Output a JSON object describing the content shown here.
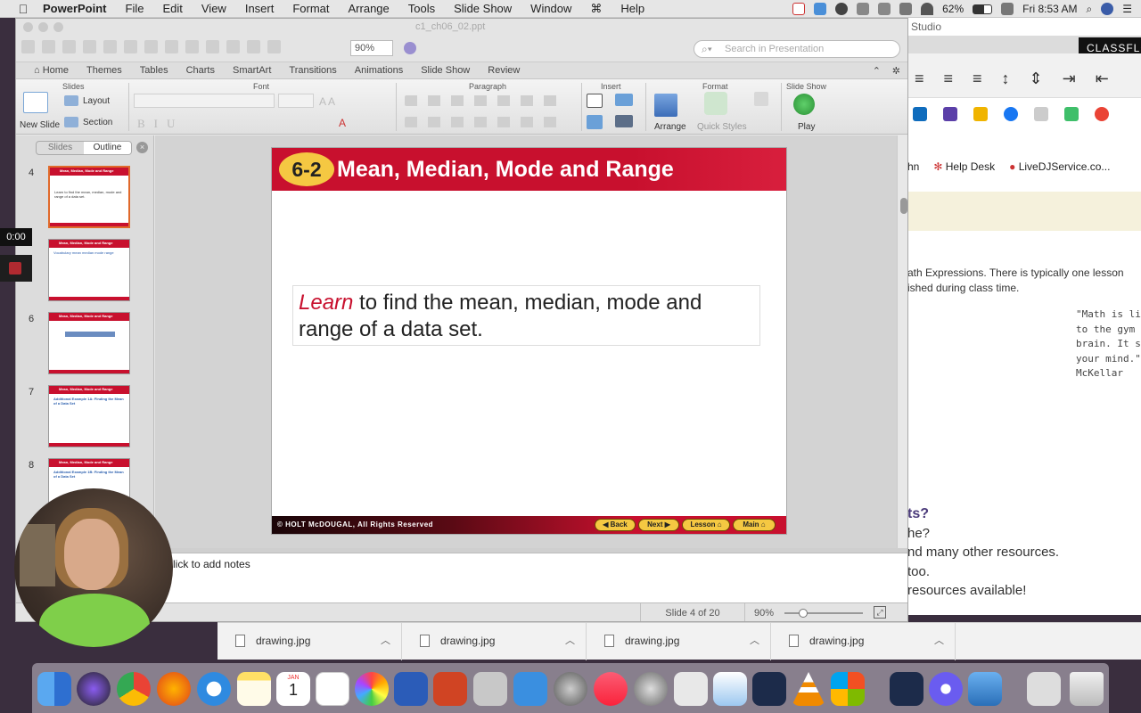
{
  "menubar": {
    "apple_glyph": "",
    "app_name": "PowerPoint",
    "items": [
      "File",
      "Edit",
      "View",
      "Insert",
      "Format",
      "Arrange",
      "Tools",
      "Slide Show",
      "Window",
      "Help"
    ],
    "battery": "62%",
    "clock": "Fri 8:53 AM"
  },
  "ppt": {
    "filename": "c1_ch06_02.ppt",
    "zoom_box": "90%",
    "search_placeholder": "Search in Presentation",
    "ribbon_tabs": [
      "Home",
      "Themes",
      "Tables",
      "Charts",
      "SmartArt",
      "Transitions",
      "Animations",
      "Slide Show",
      "Review"
    ],
    "groups": {
      "slides": "Slides",
      "font": "Font",
      "paragraph": "Paragraph",
      "insert": "Insert",
      "format": "Format",
      "slideshow": "Slide Show"
    },
    "buttons": {
      "new_slide": "New Slide",
      "layout": "Layout",
      "section": "Section",
      "arrange": "Arrange",
      "quick_styles": "Quick Styles",
      "play": "Play"
    },
    "pane_tabs": {
      "slides": "Slides",
      "outline": "Outline"
    },
    "thumbnails": [
      {
        "num": "4",
        "title": "Mean, Median, Mode and Range",
        "body": "Learn to find the mean, median, mode and range of a data set."
      },
      {
        "num": "",
        "title": "Mean, Median, Mode and Range",
        "body": "Vocabulary  mean  median  mode  range"
      },
      {
        "num": "6",
        "title": "Mean, Median, Mode and Range",
        "body": ""
      },
      {
        "num": "7",
        "title": "Mean, Median, Mode and Range",
        "body": "Additional Example 1A: Finding the Mean of a Data Set"
      },
      {
        "num": "8",
        "title": "Mean, Median, Mode and Range",
        "body": "Additional Example 1B: Finding the Mean of a Data Set"
      }
    ],
    "slide": {
      "lesson_number": "6-2",
      "title": "Mean, Median, Mode and Range",
      "learn_word": "Learn",
      "learn_rest": " to find the mean, median, mode and range of a data set.",
      "copyright": "© HOLT McDOUGAL, All Rights Reserved",
      "nav": [
        "Back",
        "Next",
        "Lesson",
        "Main"
      ]
    },
    "notes_placeholder": "lick to add notes",
    "status": {
      "slide_info": "Slide 4 of 20",
      "zoom": "90%"
    }
  },
  "recording": {
    "timer": "0:00"
  },
  "browser": {
    "studio": "Studio",
    "classflow": "CLASSFLO",
    "bookmarks": [
      "hn",
      "Help Desk",
      "LiveDJService.co..."
    ],
    "text_lines": [
      "ath Expressions. There is typically one lesson",
      "ished during class time."
    ],
    "quote_lines": [
      "\"Math is li",
      "to the gym",
      "brain. It s",
      "your mind.\"",
      "McKellar"
    ],
    "section_heading": "ts?",
    "section_lines": [
      "he?",
      "nd many other resources.",
      "too.",
      " resources available!"
    ]
  },
  "downloads": [
    "drawing.jpg",
    "drawing.jpg",
    "drawing.jpg",
    "drawing.jpg"
  ],
  "dock": {
    "apps": [
      "Finder",
      "Siri",
      "Chrome",
      "Firefox",
      "Safari",
      "Notes",
      "Calendar",
      "Reminders",
      "Photos",
      "Word",
      "PowerPoint",
      "Script Editor",
      "TextEdit",
      "Launchpad",
      "Music",
      "System Preferences",
      "Screenshot",
      "Preview",
      "Preview",
      "VLC",
      "Microsoft Remote Desktop",
      "Preview",
      "Settings",
      "Image Capture",
      "Screen Sharing",
      "Trash"
    ],
    "calendar_month": "JAN",
    "calendar_day": "1"
  },
  "colors": {
    "slide_red": "#c8102e",
    "lesson_yellow": "#f5c842",
    "selected_thumb": "#e0692b"
  }
}
